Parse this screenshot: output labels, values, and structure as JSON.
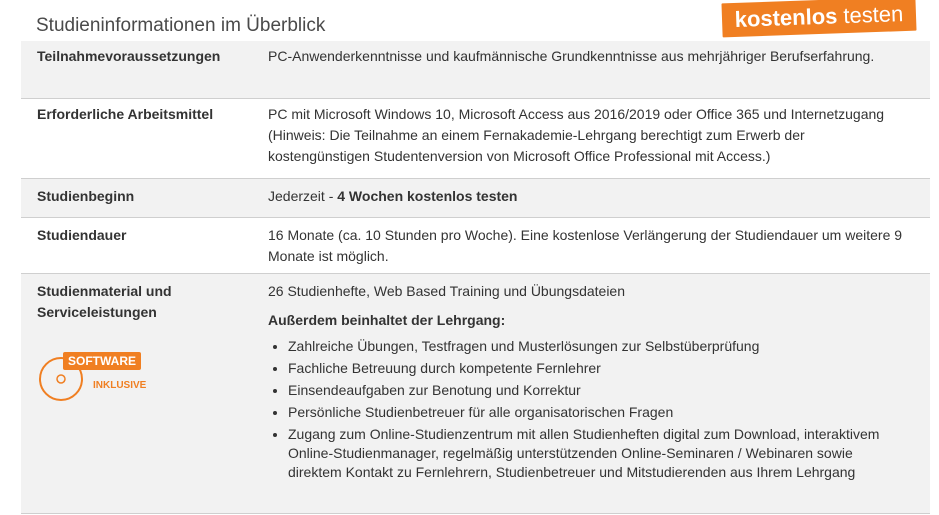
{
  "header": {
    "title": "Studieninformationen im Überblick",
    "cta_bold": "kostenlos",
    "cta_rest": "testen"
  },
  "rows": [
    {
      "label": "Teilnahmevoraussetzungen",
      "value": "PC-Anwenderkenntnisse und kaufmännische Grundkenntnisse aus mehrjähriger Berufserfahrung."
    },
    {
      "label": "Erforderliche Arbeitsmittel",
      "value": "PC mit Microsoft Windows 10, Microsoft Access aus 2016/2019 oder Office 365 und Internetzugang (Hinweis: Die Teilnahme an einem Fernakademie-Lehrgang berechtigt zum Erwerb der kostengünstigen Studentenversion von Microsoft Office Professional mit Access.)"
    },
    {
      "label": "Studienbeginn",
      "value_prefix": "Jederzeit - ",
      "value_bold": "4 Wochen kostenlos testen"
    },
    {
      "label": "Studiendauer",
      "value": "16 Monate (ca. 10 Stunden pro Woche). Eine kostenlose Verlängerung der Studiendauer um weitere 9 Monate ist möglich."
    },
    {
      "label": "Studienmaterial und Serviceleistungen",
      "value": "26 Studienhefte, Web Based Training und Übungsdateien",
      "subhead": "Außerdem beinhaltet der Lehrgang:",
      "items": [
        "Zahlreiche Übungen, Testfragen und Musterlösungen zur Selbstüberprüfung",
        "Fachliche Betreuung durch kompetente Fernlehrer",
        "Einsendeaufgaben zur Benotung und Korrektur",
        "Persönliche Studienbetreuer für alle organisatorischen Fragen",
        "Zugang zum Online-Studienzentrum mit allen Studienheften digital zum Download, interaktivem Online-Studienmanager, regelmäßig unterstützenden Online-Seminaren / Webinaren sowie direktem Kontakt zu Fernlehrern, Studienbetreuer und Mitstudierenden aus Ihrem Lehrgang"
      ],
      "badge_software": "SOFTWARE",
      "badge_inklusive": "INKLUSIVE"
    }
  ],
  "colors": {
    "accent": "#f07f22",
    "row_gray": "#f2f2f2",
    "text": "#333333"
  }
}
